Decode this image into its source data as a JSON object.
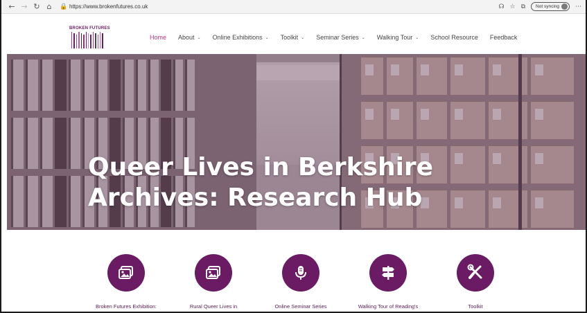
{
  "browser": {
    "url": "https://www.brokenfutures.co.uk",
    "sync_label": "Not syncing",
    "back_icon": "arrow-left-icon",
    "forward_icon": "arrow-right-icon",
    "refresh_icon": "refresh-icon",
    "home_icon": "home-icon"
  },
  "site": {
    "logo_text": "BROKEN FUTURES",
    "logo_colors": [
      "#b8377f",
      "#6a1b63",
      "#8a4fb0",
      "#c45a9a",
      "#2f2f2f",
      "#9a2c74",
      "#6a1b63",
      "#d47fb0",
      "#5a2b7a",
      "#b8377f",
      "#444444",
      "#8a4fb0",
      "#c45a9a",
      "#6a1b63"
    ],
    "accent_color": "#6a1b63",
    "active_color": "#b8377f"
  },
  "nav": {
    "items": [
      {
        "label": "Home",
        "dropdown": false,
        "active": true
      },
      {
        "label": "About",
        "dropdown": true,
        "active": false
      },
      {
        "label": "Online Exhibitions",
        "dropdown": true,
        "active": false
      },
      {
        "label": "Toolkit",
        "dropdown": true,
        "active": false
      },
      {
        "label": "Seminar Series",
        "dropdown": true,
        "active": false
      },
      {
        "label": "Walking Tour",
        "dropdown": true,
        "active": false
      },
      {
        "label": "School Resource",
        "dropdown": false,
        "active": false
      },
      {
        "label": "Feedback",
        "dropdown": false,
        "active": false
      }
    ]
  },
  "hero": {
    "title_line1": "Queer Lives in Berkshire",
    "title_line2": "Archives: Research Hub"
  },
  "features": [
    {
      "label": "Broken Futures Exhibition:",
      "icon": "gallery-icon"
    },
    {
      "label": "Rural Queer Lives in",
      "icon": "gallery-icon"
    },
    {
      "label": "Online Seminar Series",
      "icon": "microphone-icon"
    },
    {
      "label": "Walking Tour of Reading's",
      "icon": "signpost-icon"
    },
    {
      "label": "Toolkit",
      "icon": "tools-icon"
    }
  ]
}
